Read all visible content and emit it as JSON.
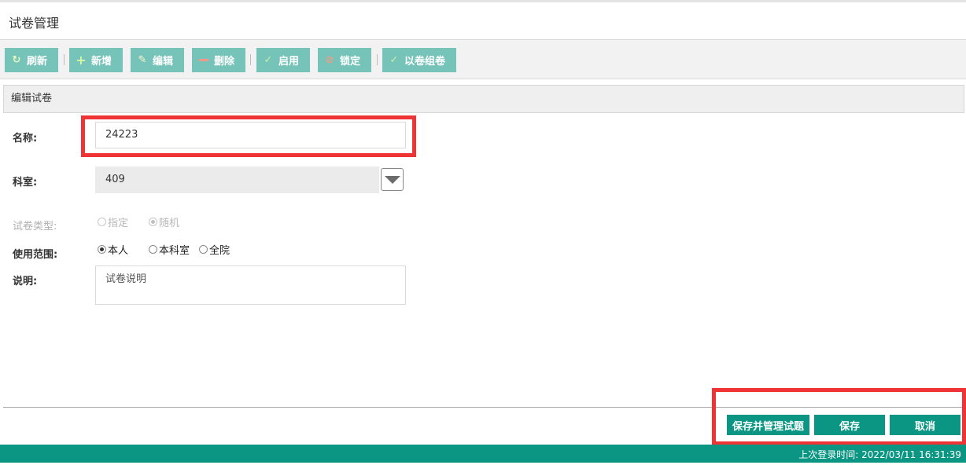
{
  "page": {
    "title": "试卷管理"
  },
  "toolbar": {
    "buttons": [
      {
        "label": "刷新",
        "icon": "refresh-icon"
      },
      {
        "label": "新增",
        "icon": "plus-icon"
      },
      {
        "label": "编辑",
        "icon": "pencil-icon"
      },
      {
        "label": "删除",
        "icon": "minus-icon"
      },
      {
        "label": "启用",
        "icon": "check-icon"
      },
      {
        "label": "锁定",
        "icon": "ban-icon"
      },
      {
        "label": "以卷组卷",
        "icon": "check-icon"
      }
    ]
  },
  "panel": {
    "title": "编辑试卷"
  },
  "form": {
    "name": {
      "label": "名称:",
      "value": "24223"
    },
    "department": {
      "label": "科室:",
      "value": "409"
    },
    "paper_type": {
      "label": "试卷类型:",
      "options": [
        "指定",
        "随机"
      ],
      "selected": "随机",
      "disabled": true
    },
    "scope": {
      "label": "使用范围:",
      "options": [
        "本人",
        "本科室",
        "全院"
      ],
      "selected": "本人"
    },
    "description": {
      "label": "说明:",
      "value": "试卷说明"
    }
  },
  "actions": {
    "save_manage": "保存并管理试题",
    "save": "保存",
    "cancel": "取消"
  },
  "status": {
    "last_login": "上次登录时间: 2022/03/11 16:31:39"
  },
  "colors": {
    "toolbar_button": "#76c4b9",
    "primary": "#0a9682",
    "highlight": "#ee3434"
  }
}
